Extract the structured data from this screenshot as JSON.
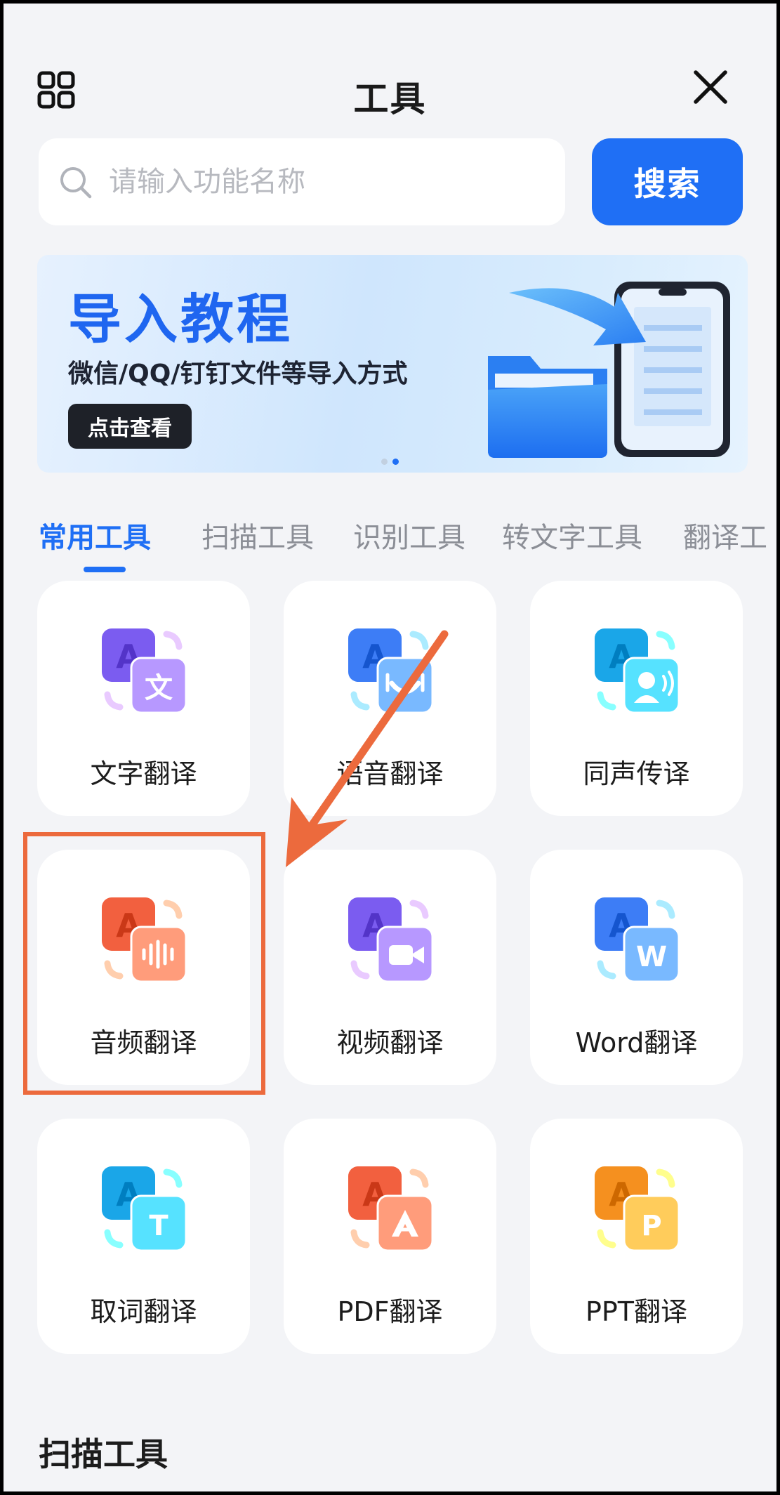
{
  "header": {
    "title": "工具"
  },
  "search": {
    "placeholder": "请输入功能名称",
    "button_label": "搜索"
  },
  "banner": {
    "title": "导入教程",
    "subtitle": "微信/QQ/钉钉文件等导入方式",
    "button_label": "点击查看",
    "slide_count": 2,
    "active_slide": 2
  },
  "tabs": [
    {
      "label": "常用工具",
      "active": true
    },
    {
      "label": "扫描工具",
      "active": false
    },
    {
      "label": "识别工具",
      "active": false
    },
    {
      "label": "转文字工具",
      "active": false
    },
    {
      "label": "翻译工",
      "active": false
    }
  ],
  "tools": [
    {
      "label": "文字翻译",
      "icon": "text-translate-icon",
      "color": "#7b5cf0",
      "glyph": "文"
    },
    {
      "label": "语音翻译",
      "icon": "voice-translate-icon",
      "color": "#3d7df6",
      "glyph": ""
    },
    {
      "label": "同声传译",
      "icon": "simultaneous-interpret-icon",
      "color": "#1aa6e8",
      "glyph": ""
    },
    {
      "label": "音频翻译",
      "icon": "audio-translate-icon",
      "color": "#f2603f",
      "glyph": ""
    },
    {
      "label": "视频翻译",
      "icon": "video-translate-icon",
      "color": "#7b5cf0",
      "glyph": ""
    },
    {
      "label": "Word翻译",
      "icon": "word-translate-icon",
      "color": "#3d7df6",
      "glyph": "W"
    },
    {
      "label": "取词翻译",
      "icon": "word-pick-translate-icon",
      "color": "#1aa6e8",
      "glyph": "T"
    },
    {
      "label": "PDF翻译",
      "icon": "pdf-translate-icon",
      "color": "#f2603f",
      "glyph": ""
    },
    {
      "label": "PPT翻译",
      "icon": "ppt-translate-icon",
      "color": "#f5901f",
      "glyph": "P"
    }
  ],
  "section": {
    "title": "扫描工具"
  },
  "colors": {
    "accent": "#1f6ff5",
    "annotation": "#ec6a3d",
    "background": "#f3f4f7"
  }
}
